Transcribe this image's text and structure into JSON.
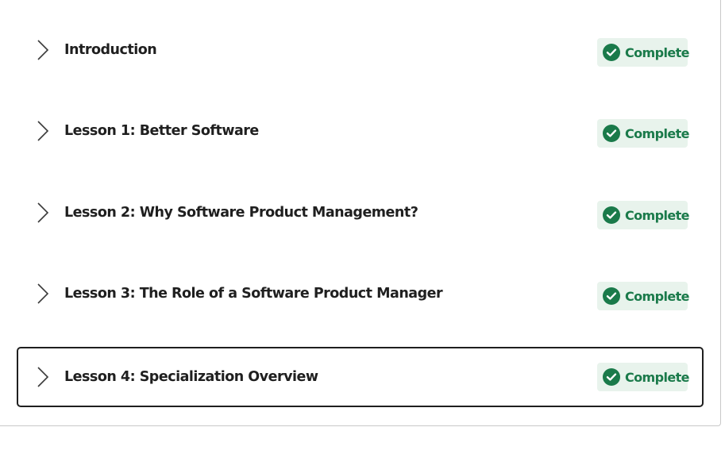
{
  "lessons": [
    {
      "title": "Introduction",
      "status": "Complete"
    },
    {
      "title": "Lesson 1: Better Software",
      "status": "Complete"
    },
    {
      "title": "Lesson 2: Why Software Product Management?",
      "status": "Complete"
    },
    {
      "title": "Lesson 3: The Role of a Software Product Manager",
      "status": "Complete"
    },
    {
      "title": "Lesson 4: Specialization Overview",
      "status": "Complete"
    }
  ],
  "colors": {
    "status_complete": "#1a7a4a",
    "status_complete_bg": "#e8f3ec",
    "text": "#1f1f1f",
    "focus_border": "#1f1f1f"
  },
  "icons": {
    "expand": "chevron-right-icon",
    "status": "check-circle-icon"
  }
}
